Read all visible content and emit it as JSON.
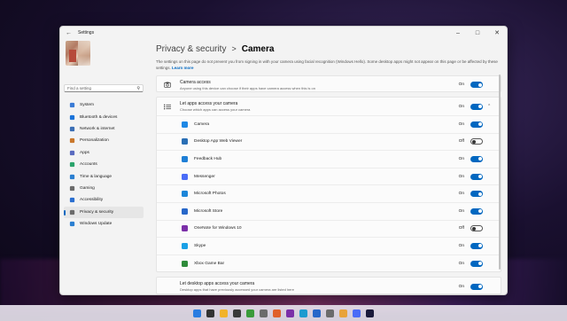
{
  "window": {
    "title": "Settings",
    "minimize_icon": "minimize-icon",
    "maximize_icon": "maximize-icon",
    "close_icon": "close-icon"
  },
  "sidebar": {
    "search_placeholder": "Find a setting",
    "items": [
      {
        "label": "System",
        "icon": "system-icon",
        "color": "#3a7bd5"
      },
      {
        "label": "Bluetooth & devices",
        "icon": "bluetooth-icon",
        "color": "#1a73d9"
      },
      {
        "label": "Network & internet",
        "icon": "network-icon",
        "color": "#3b6fb5"
      },
      {
        "label": "Personalization",
        "icon": "brush-icon",
        "color": "#c9772b"
      },
      {
        "label": "Apps",
        "icon": "apps-icon",
        "color": "#5a6bbf"
      },
      {
        "label": "Accounts",
        "icon": "accounts-icon",
        "color": "#2aa36b"
      },
      {
        "label": "Time & language",
        "icon": "time-icon",
        "color": "#2b7fd1"
      },
      {
        "label": "Gaming",
        "icon": "gaming-icon",
        "color": "#6b6b6b"
      },
      {
        "label": "Accessibility",
        "icon": "accessibility-icon",
        "color": "#2b6fd0"
      },
      {
        "label": "Privacy & security",
        "icon": "shield-icon",
        "color": "#6b6b6b",
        "active": true
      },
      {
        "label": "Windows Update",
        "icon": "update-icon",
        "color": "#2b7fd1"
      }
    ]
  },
  "header": {
    "breadcrumb_parent": "Privacy & security",
    "separator": ">",
    "current": "Camera"
  },
  "note": {
    "text": "The settings on this page do not prevent you from signing in with your camera using facial recognition (Windows Hello). Some desktop apps might not appear on this page or be affected by these settings.",
    "link": "Learn more"
  },
  "camera_access": {
    "title": "Camera access",
    "description": "Anyone using this device can choose if their apps have camera access when this is on",
    "state": "On"
  },
  "let_apps": {
    "title": "Let apps access your camera",
    "description": "Choose which apps can access your camera",
    "state": "On"
  },
  "apps": [
    {
      "name": "Camera",
      "state": "On",
      "color": "#1e88e5"
    },
    {
      "name": "Desktop App Web Viewer",
      "state": "Off",
      "color": "#2a6fb5"
    },
    {
      "name": "Feedback Hub",
      "state": "On",
      "color": "#1f7fd6"
    },
    {
      "name": "Messenger",
      "state": "On",
      "color": "#4a6cf7"
    },
    {
      "name": "Microsoft Photos",
      "state": "On",
      "color": "#1c86d9"
    },
    {
      "name": "Microsoft Store",
      "state": "On",
      "color": "#2767c9"
    },
    {
      "name": "OneNote for Windows 10",
      "state": "Off",
      "color": "#7b2fa8"
    },
    {
      "name": "Skype",
      "state": "On",
      "color": "#1aa0e6"
    },
    {
      "name": "Xbox Game Bar",
      "state": "On",
      "color": "#2e8b3a"
    }
  ],
  "desktop_apps": {
    "title": "Let desktop apps access your camera",
    "description": "Desktop apps that have previously accessed your camera are listed here",
    "state": "On"
  },
  "taskbar": [
    {
      "icon": "windows-start-icon",
      "color": "#2a7de1"
    },
    {
      "icon": "search-icon",
      "color": "#333333"
    },
    {
      "icon": "file-explorer-icon",
      "color": "#f2b32a"
    },
    {
      "icon": "badge-app-icon",
      "color": "#3a3a3a"
    },
    {
      "icon": "chrome-icon",
      "color": "#3b9b3b"
    },
    {
      "icon": "chrome-beta-icon",
      "color": "#6b6b6b"
    },
    {
      "icon": "app-orange-icon",
      "color": "#e0602a"
    },
    {
      "icon": "onenote-icon",
      "color": "#7b2fa8"
    },
    {
      "icon": "edge-icon",
      "color": "#1c9bd0"
    },
    {
      "icon": "store-icon",
      "color": "#2767c9"
    },
    {
      "icon": "settings-icon",
      "color": "#6b6b6b"
    },
    {
      "icon": "folder-icon",
      "color": "#e8a33a"
    },
    {
      "icon": "messenger-icon",
      "color": "#4a6cf7"
    },
    {
      "icon": "premiere-icon",
      "color": "#1a1a3a"
    }
  ]
}
